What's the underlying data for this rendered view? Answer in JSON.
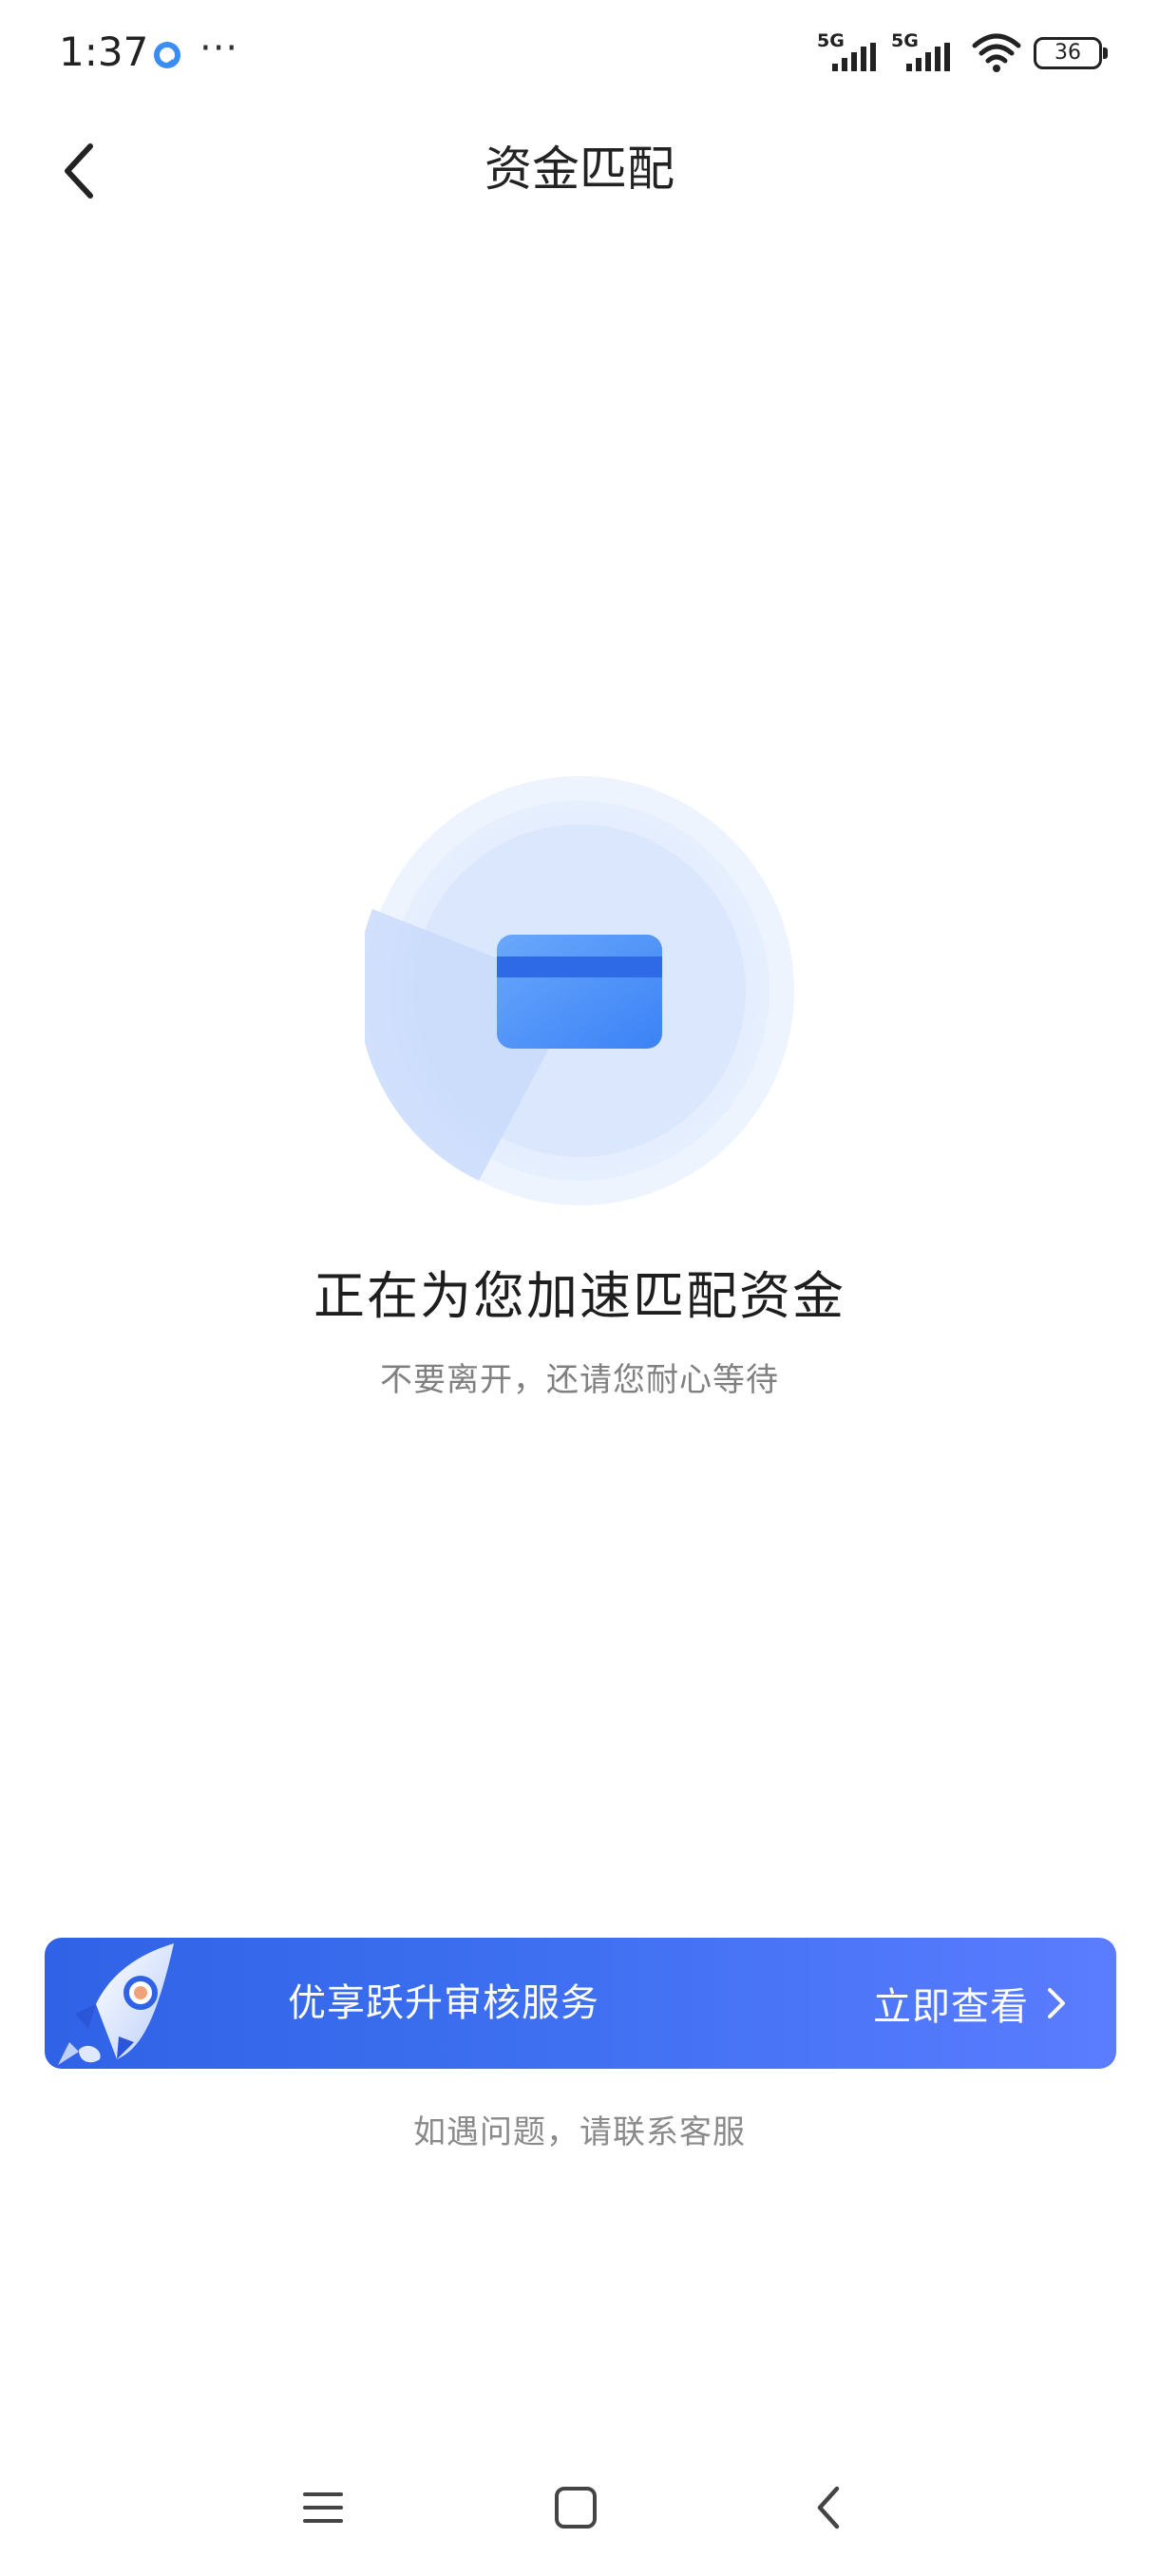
{
  "status_bar": {
    "time": "1:37",
    "more": "···",
    "network_1": "5G",
    "network_2": "5G",
    "battery": "36",
    "icons": [
      "app-notification-icon",
      "signal-icon",
      "signal-icon",
      "wifi-icon",
      "battery-icon"
    ]
  },
  "header": {
    "title": "资金匹配",
    "back_icon": "chevron-left-icon"
  },
  "loader": {
    "icon": "credit-card-icon",
    "title": "正在为您加速匹配资金",
    "subtitle": "不要离开，还请您耐心等待"
  },
  "promo": {
    "text": "优享跃升审核服务",
    "cta": "立即查看",
    "icon": "rocket-icon",
    "colors": {
      "start": "#2f62e6",
      "end": "#5b7cff"
    }
  },
  "help": {
    "text": "如遇问题，请联系客服"
  },
  "system_nav": {
    "icons": [
      "menu-icon",
      "home-icon",
      "back-icon"
    ]
  },
  "colors": {
    "accent": "#3d6ff0",
    "card": "#4c8dfa",
    "halo": "#dfeafe"
  }
}
